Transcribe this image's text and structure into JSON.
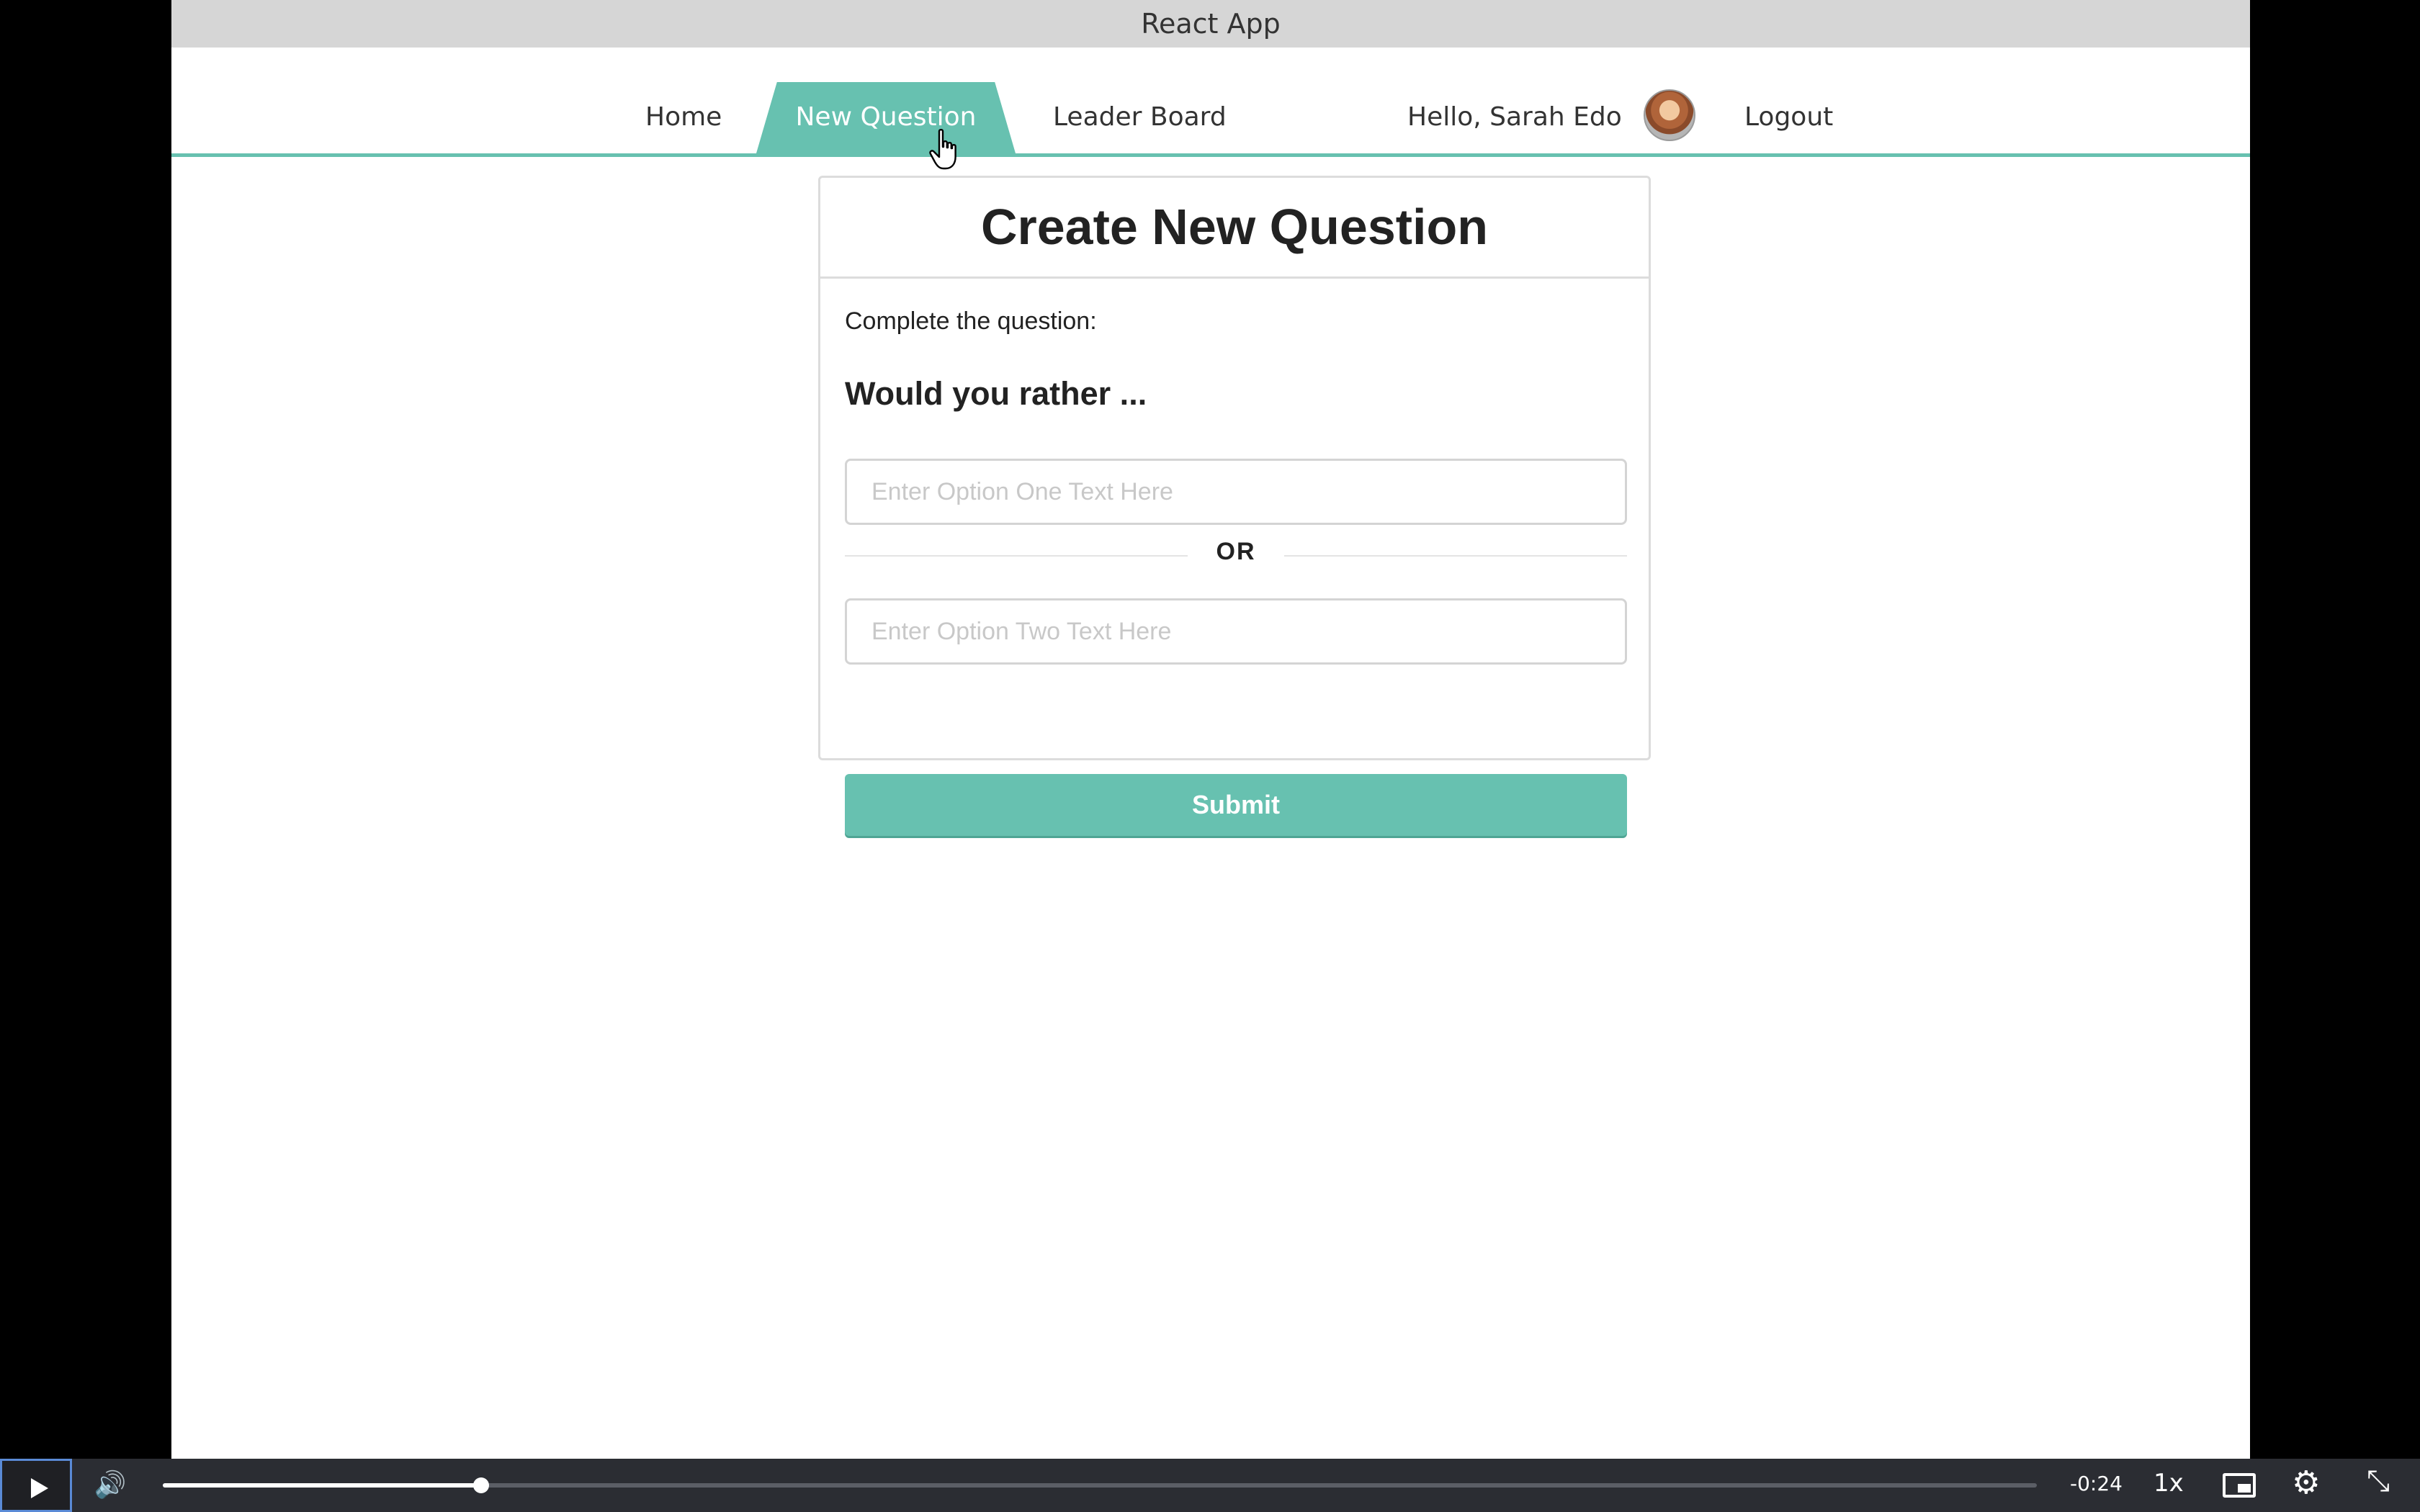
{
  "window": {
    "title": "React App"
  },
  "nav": {
    "home": "Home",
    "new_question": "New Question",
    "leader_board": "Leader Board",
    "greeting": "Hello, Sarah Edo",
    "logout": "Logout",
    "active_tab": "New Question"
  },
  "form": {
    "heading": "Create New Question",
    "instruction": "Complete the question:",
    "prompt": "Would you rather ...",
    "option_one": {
      "value": "",
      "placeholder": "Enter Option One Text Here"
    },
    "separator": "OR",
    "option_two": {
      "value": "",
      "placeholder": "Enter Option Two Text Here"
    },
    "submit_label": "Submit"
  },
  "player": {
    "time_remaining": "-0:24",
    "speed": "1x",
    "progress": 0.17
  },
  "colors": {
    "accent": "#67c1b0",
    "player_bar": "#2b2d33"
  },
  "icons": {
    "play": "play-icon",
    "volume": "volume-icon",
    "pip": "picture-in-picture-icon",
    "settings": "gear-icon",
    "fullscreen": "exit-fullscreen-icon",
    "cursor": "hand-pointer-icon"
  }
}
